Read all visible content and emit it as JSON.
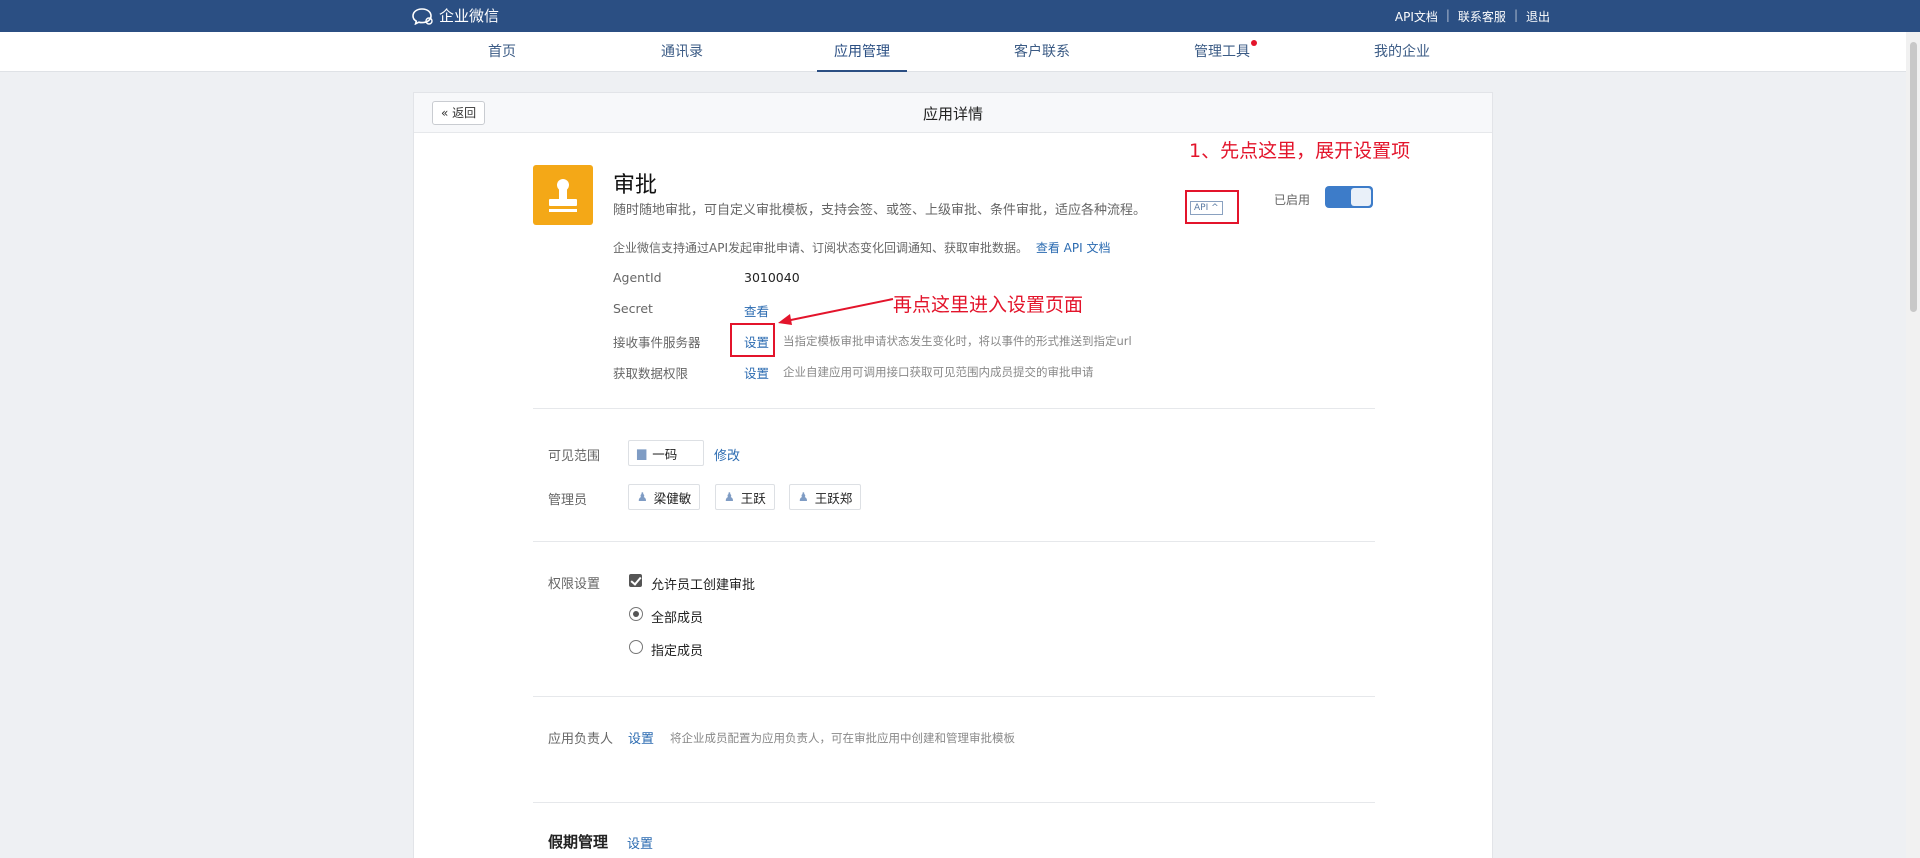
{
  "topbar": {
    "brand": "企业微信",
    "links": [
      "API文档",
      "联系客服",
      "退出"
    ]
  },
  "nav": {
    "items": [
      "首页",
      "通讯录",
      "应用管理",
      "客户联系",
      "管理工具",
      "我的企业"
    ],
    "active": "应用管理"
  },
  "panel": {
    "back_label": "返回",
    "title": "应用详情"
  },
  "app": {
    "name": "审批",
    "description": "随时随地审批，可自定义审批模板，支持会签、或签、上级审批、条件审批，适应各种流程。",
    "api_tag": "API ^",
    "enabled_label": "已启用",
    "enabled": true,
    "api_note": "企业微信支持通过API发起审批申请、订阅状态变化回调通知、获取审批数据。",
    "api_doc_link": "查看 API 文档",
    "icon_color": "#f4a817"
  },
  "details": [
    {
      "label": "AgentId",
      "value": "3010040"
    },
    {
      "label": "Secret",
      "link": "查看"
    },
    {
      "label": "接收事件服务器",
      "link": "设置",
      "hint": "当指定模板审批申请状态发生变化时，将以事件的形式推送到指定url"
    },
    {
      "label": "获取数据权限",
      "link": "设置",
      "hint": "企业自建应用可调用接口获取可见范围内成员提交的审批申请"
    }
  ],
  "visibility": {
    "label": "可见范围",
    "chip": "一码",
    "edit_link": "修改"
  },
  "admins": {
    "label": "管理员",
    "people": [
      "梁健敏",
      "王跃",
      "王跃郑"
    ]
  },
  "permissions": {
    "label": "权限设置",
    "allow_create": "允许员工创建审批",
    "options": [
      "全部成员",
      "指定成员"
    ],
    "selected": "全部成员"
  },
  "owner": {
    "label": "应用负责人",
    "link": "设置",
    "hint": "将企业成员配置为应用负责人，可在审批应用中创建和管理审批模板"
  },
  "holiday": {
    "label": "假期管理",
    "link": "设置"
  },
  "annotations": {
    "step1": "1、先点这里，展开设置项",
    "step2": "再点这里进入设置页面"
  },
  "colors": {
    "accent": "#2b4f83",
    "link": "#2b6bb1",
    "annotation": "#e3142b"
  }
}
